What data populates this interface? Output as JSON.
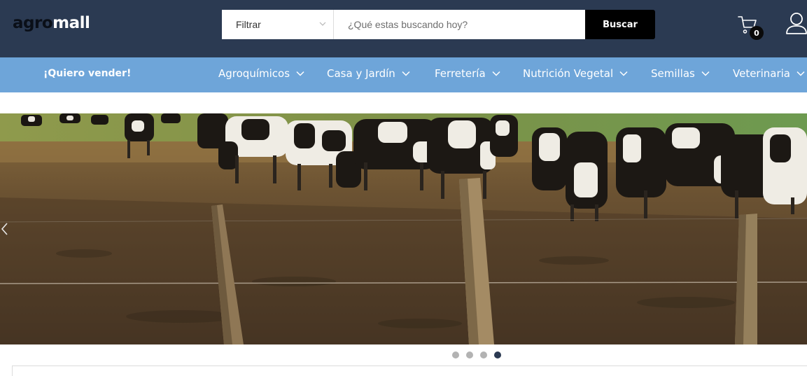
{
  "header": {
    "logo_part1": "agro",
    "logo_part2": "mall",
    "filter_label": "Filtrar",
    "search_placeholder": "¿Qué estas buscando hoy?",
    "search_button": "Buscar",
    "cart_count": "0",
    "cart_icon": "cart-icon",
    "user_icon": "user-icon",
    "background_color": "#2b3a52"
  },
  "nav": {
    "sell_link": "¡Quiero vender!",
    "background_color": "#6ea5d9",
    "items": [
      {
        "label": "Agroquímicos"
      },
      {
        "label": "Casa y Jardín"
      },
      {
        "label": "Ferretería"
      },
      {
        "label": "Nutrición Vegetal"
      },
      {
        "label": "Semillas"
      },
      {
        "label": "Veterinaria"
      }
    ]
  },
  "carousel": {
    "slides": [
      {
        "active": false
      },
      {
        "active": false
      },
      {
        "active": false
      },
      {
        "active": true
      }
    ],
    "prev_icon": "chevron-left-icon"
  }
}
